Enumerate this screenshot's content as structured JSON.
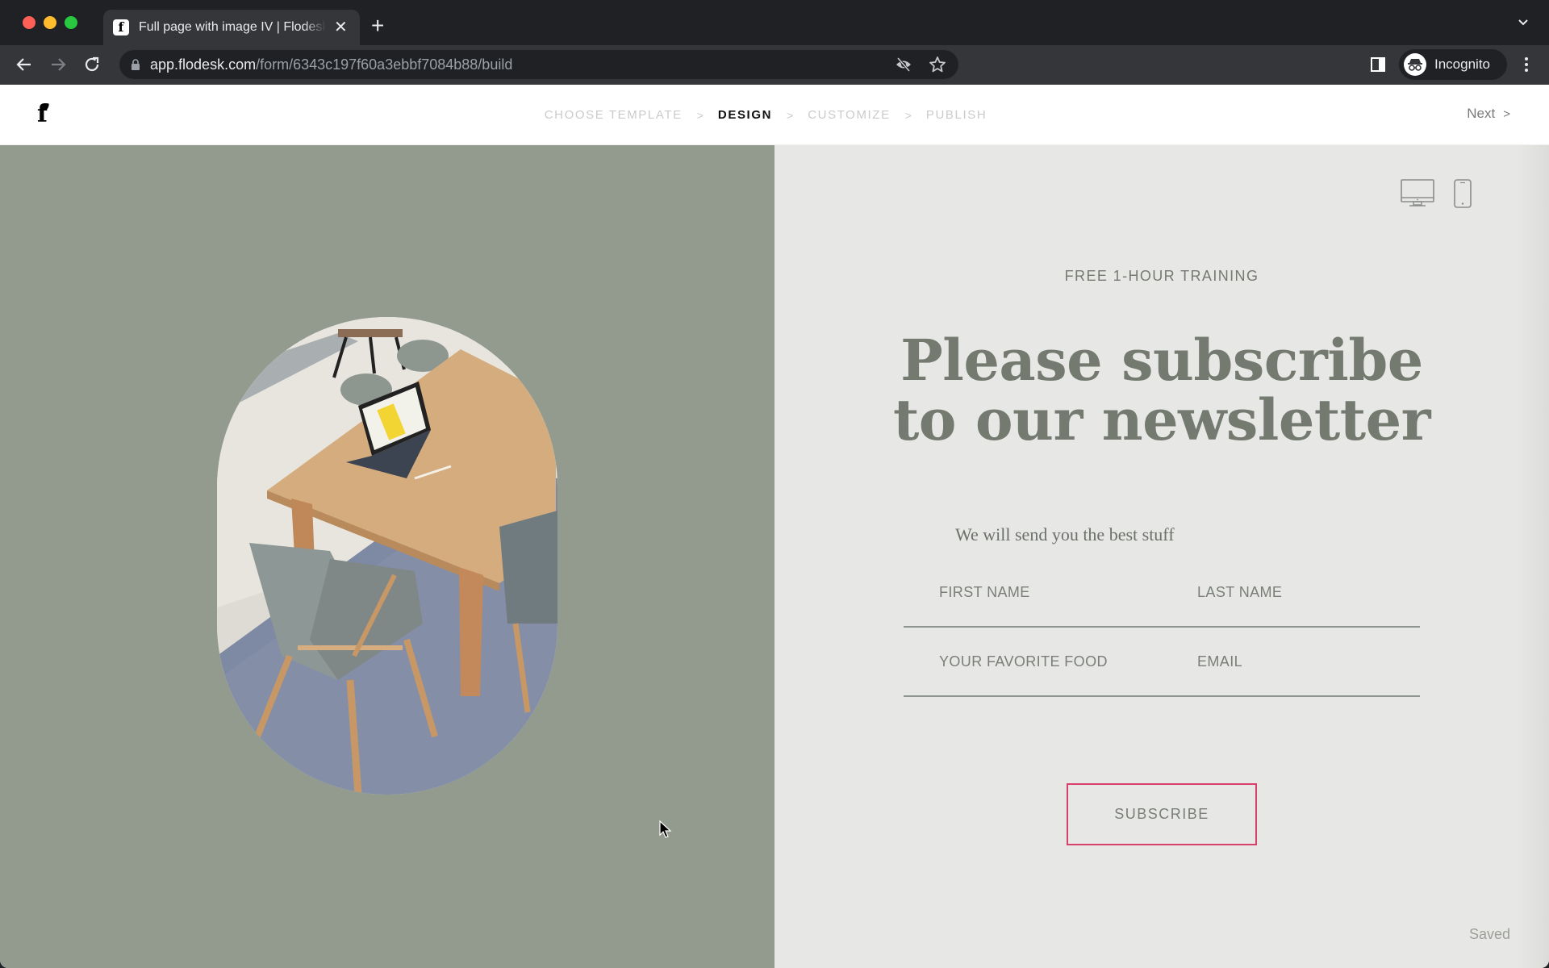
{
  "browser": {
    "tab": {
      "title": "Full page with image IV | Flodesk",
      "favicon": "flodesk-f-icon"
    },
    "url": {
      "host": "app.flodesk.com",
      "path": "/form/6343c197f60a3ebbf7084b88/build"
    },
    "profile_label": "Incognito"
  },
  "header": {
    "logo_text": "f",
    "steps": [
      {
        "label": "CHOOSE TEMPLATE",
        "active": false
      },
      {
        "label": "DESIGN",
        "active": true
      },
      {
        "label": "CUSTOMIZE",
        "active": false
      },
      {
        "label": "PUBLISH",
        "active": false
      }
    ],
    "step_separator": ">",
    "next_label": "Next",
    "next_chevron": ">"
  },
  "form": {
    "eyebrow": "FREE 1-HOUR TRAINING",
    "headline_line1": "Please subscribe",
    "headline_line2": "to our newsletter",
    "subtext": "We will send you the best stuff",
    "fields": [
      {
        "placeholder": "FIRST NAME",
        "value": ""
      },
      {
        "placeholder": "LAST NAME",
        "value": ""
      },
      {
        "placeholder": "YOUR FAVORITE FOOD",
        "value": ""
      },
      {
        "placeholder": "EMAIL",
        "value": ""
      }
    ],
    "subscribe_label": "SUBSCRIBE"
  },
  "status": {
    "saved_label": "Saved"
  },
  "colors": {
    "left_background": "#929b8e",
    "right_background": "#e7e8e5",
    "button_border": "#d8406c",
    "text_muted": "#747a70"
  }
}
